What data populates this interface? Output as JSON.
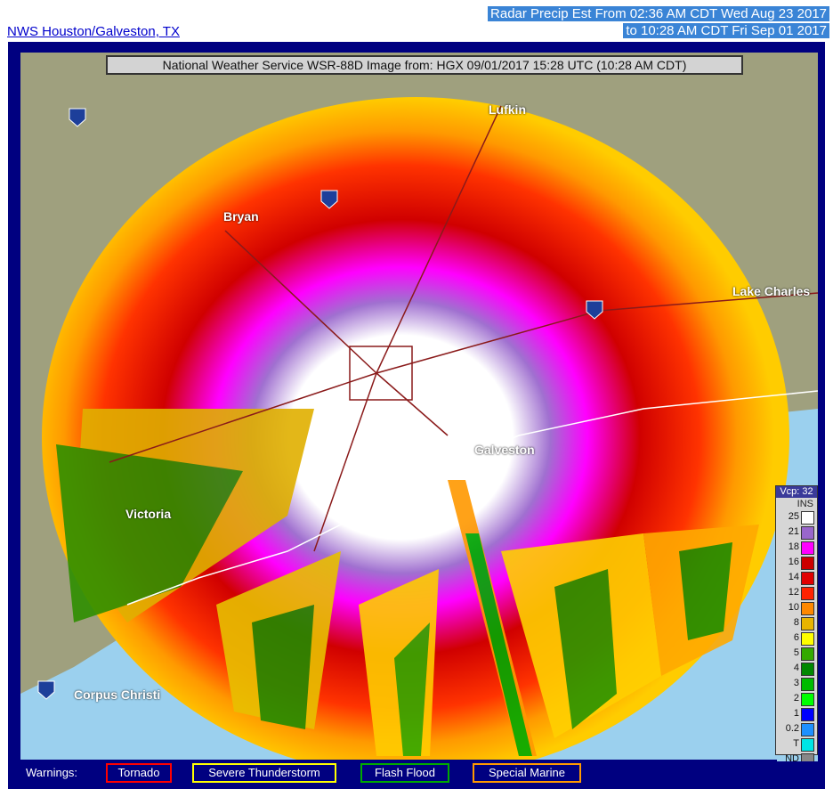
{
  "header": {
    "site_link": "NWS Houston/Galveston, TX",
    "line1": "Radar Precip Est From 02:36 AM CDT Wed Aug 23 2017",
    "line2": "to 10:28 AM CDT Fri Sep 01 2017"
  },
  "map": {
    "title": "National Weather Service WSR-88D Image from: HGX 09/01/2017 15:28 UTC (10:28 AM CDT)",
    "cities": [
      {
        "name": "Lufkin"
      },
      {
        "name": "Bryan"
      },
      {
        "name": "Lake Charles"
      },
      {
        "name": "Victoria"
      },
      {
        "name": "Galveston"
      },
      {
        "name": "Corpus Christi"
      }
    ],
    "interstates": [
      "35",
      "45",
      "10",
      "37"
    ]
  },
  "legend": {
    "head": "Vcp: 32",
    "unit": "INS",
    "rows": [
      {
        "label": "25",
        "color": "#ffffff"
      },
      {
        "label": "21",
        "color": "#9966cc"
      },
      {
        "label": "18",
        "color": "#ff00ff"
      },
      {
        "label": "16",
        "color": "#cc0000"
      },
      {
        "label": "14",
        "color": "#e00000"
      },
      {
        "label": "12",
        "color": "#ff2200"
      },
      {
        "label": "10",
        "color": "#ff8800"
      },
      {
        "label": "8",
        "color": "#e8b400"
      },
      {
        "label": "6",
        "color": "#ffff00"
      },
      {
        "label": "5",
        "color": "#33aa00"
      },
      {
        "label": "4",
        "color": "#008800"
      },
      {
        "label": "3",
        "color": "#00bb00"
      },
      {
        "label": "2",
        "color": "#00ff00"
      },
      {
        "label": "1",
        "color": "#0000ff"
      },
      {
        "label": "0.2",
        "color": "#1e90ff"
      },
      {
        "label": "T",
        "color": "#00e5e5"
      },
      {
        "label": "ND",
        "color": "#888888"
      }
    ]
  },
  "warnings": {
    "label": "Warnings:",
    "items": [
      {
        "label": "Tornado",
        "color": "#ff0000"
      },
      {
        "label": "Severe Thunderstorm",
        "color": "#ffff00"
      },
      {
        "label": "Flash Flood",
        "color": "#00aa00"
      },
      {
        "label": "Special Marine",
        "color": "#ff9900"
      }
    ]
  }
}
